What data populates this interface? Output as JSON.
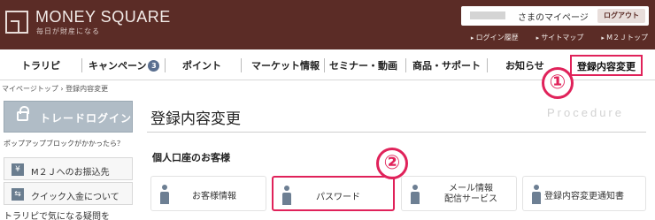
{
  "header": {
    "logo_title": "MONEY SQUARE",
    "logo_subtitle": "毎日が財産になる",
    "user_suffix": "さまのマイページ",
    "logout_label": "ログアウト",
    "util_links": [
      "ログイン履歴",
      "サイトマップ",
      "M２Ｊトップ"
    ]
  },
  "nav": {
    "items": [
      "トラリピ",
      "キャンペーン",
      "ポイント",
      "マーケット情報",
      "セミナー・動画",
      "商品・サポート",
      "お知らせ"
    ],
    "campaign_badge": "3",
    "active_label": "登録内容変更"
  },
  "breadcrumb": "マイページトップ › 登録内容変更",
  "sidebar": {
    "trade_login": "トレードログイン",
    "popup_note": "ポップアップブロックがかかったら？",
    "links": [
      "M２Ｊへのお振込先",
      "クイック入金について"
    ],
    "faq": "トラリピで気になる疑問を"
  },
  "main": {
    "page_title": "登録内容変更",
    "procedure_label": "Procedure",
    "section_title": "個人口座のお客様",
    "cards": {
      "customer_info": "お客様情報",
      "password": "パスワード",
      "mail_line1": "メール情報",
      "mail_line2": "配信サービス",
      "notice": "登録内容変更通知書"
    }
  },
  "annotations": [
    "①",
    "②"
  ],
  "colors": {
    "header_bg": "#5b2c26",
    "highlight": "#e0225a",
    "icon": "#6d7f93",
    "badge": "#5a6f90"
  }
}
